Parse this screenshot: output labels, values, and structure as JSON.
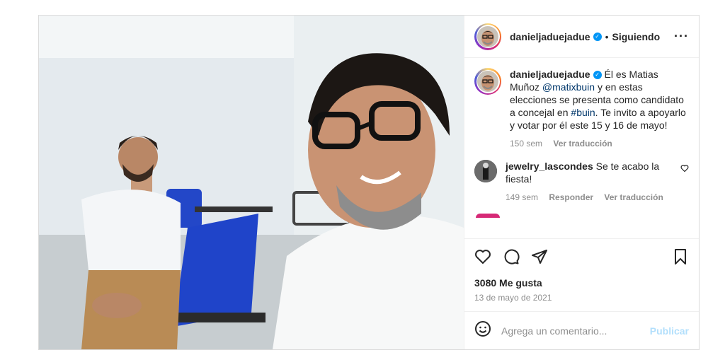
{
  "post": {
    "username": "danieljaduejadue",
    "follow_status": "Siguiendo",
    "caption": {
      "username": "danieljaduejadue",
      "text_1": "Él es Matias Muñoz ",
      "mention": "@matixbuin",
      "text_2": " y en estas elecciones se presenta como candidato a concejal en ",
      "hashtag": "#buin",
      "text_3": ". Te invito a apoyarlo y votar por él este 15 y 16 de mayo!",
      "time": "150 sem",
      "translate": "Ver traducción"
    },
    "comments": [
      {
        "username": "jewelry_lascondes",
        "text": "Se te acabo la fiesta!",
        "time": "149 sem",
        "reply": "Responder",
        "translate": "Ver traducción"
      }
    ],
    "likes": "3080 Me gusta",
    "date": "13 de mayo de 2021",
    "comment_placeholder": "Agrega un comentario...",
    "publish_label": "Publicar"
  },
  "icons": {
    "like": "heart-icon",
    "comment": "comment-icon",
    "share": "share-icon",
    "save": "bookmark-icon",
    "emoji": "emoji-icon",
    "more": "more-options-icon",
    "verified": "verified-badge-icon"
  },
  "colors": {
    "link": "#00376b",
    "verified": "#0095f6",
    "muted": "#8e8e8e",
    "publish_disabled": "#b2dffc"
  }
}
